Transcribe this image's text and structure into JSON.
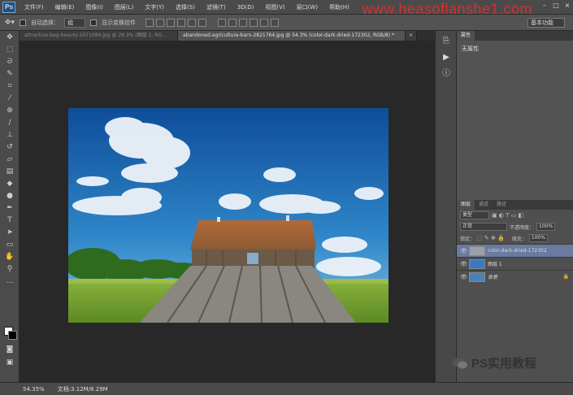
{
  "app": {
    "logo": "Ps"
  },
  "menu": [
    "文件(F)",
    "编辑(E)",
    "图像(I)",
    "图层(L)",
    "文字(Y)",
    "选择(S)",
    "滤镜(T)",
    "3D(D)",
    "视图(V)",
    "窗口(W)",
    "帮助(H)"
  ],
  "watermark_top": "www.heasoflanshe1.com",
  "options": {
    "auto_select_label": "自动选择：",
    "auto_select_value": "组",
    "show_transform_label": "显示变换控件",
    "workspace": "基本功能"
  },
  "tabs": [
    {
      "label": "attractive-bag-beauty-2071084.jpg @ 29.3% (图层 1, RG...",
      "active": false
    },
    {
      "label": "abandoned-agriculture-barn-2821764.jpg @ 54.3% (color-dark-dried-172302, RGB/8) *",
      "active": true
    }
  ],
  "panels": {
    "properties_tab": "属性",
    "properties_text": "无属性",
    "layer_tabs": [
      "图层",
      "通道",
      "路径"
    ],
    "kind_filter": "类型",
    "blend_mode": "正常",
    "opacity_label": "不透明度：",
    "opacity_value": "100%",
    "lock_label": "锁定：",
    "fill_label": "填充：",
    "fill_value": "100%",
    "layers": [
      {
        "name": "color-dark-dried-172302",
        "selected": true
      },
      {
        "name": "图层 1",
        "selected": false
      },
      {
        "name": "背景",
        "selected": false
      }
    ]
  },
  "status": {
    "zoom": "54.35%",
    "doc": "文档:3.12M/8.29M"
  },
  "brand": "PS实用教程",
  "colors": {
    "accent_red": "#e0302f",
    "selected_layer": "#6a7aa0"
  }
}
